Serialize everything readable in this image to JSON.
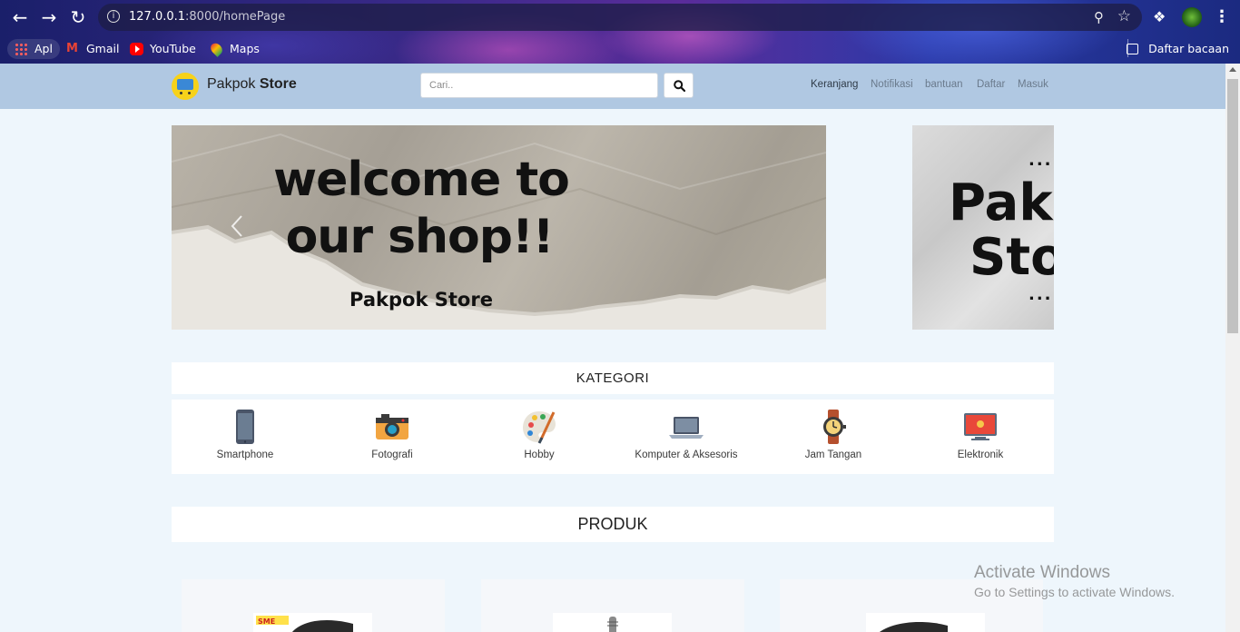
{
  "browser": {
    "url_host": "127.0.0.1",
    "url_path": ":8000/homePage",
    "bookmarks": [
      {
        "label": "Apl",
        "icon": "apps-grid-icon"
      },
      {
        "label": "Gmail",
        "icon": "gmail-icon"
      },
      {
        "label": "YouTube",
        "icon": "youtube-icon"
      },
      {
        "label": "Maps",
        "icon": "maps-icon"
      }
    ],
    "reading_list": "Daftar bacaan"
  },
  "header": {
    "brand_light": "Pakpok",
    "brand_bold": "Store",
    "search_placeholder": "Cari..",
    "nav": [
      "Keranjang",
      "Notifikasi",
      "bantuan",
      "Daftar",
      "Masuk"
    ]
  },
  "carousel": {
    "slide1_line1": "welcome to",
    "slide1_line2": "our shop!!",
    "slide1_sub": "Pakpok Store",
    "slide2_dots": "....",
    "slide2_line1": "Pakpok",
    "slide2_line2": "Store"
  },
  "kategori": {
    "title": "KATEGORI",
    "items": [
      {
        "label": "Smartphone",
        "icon": "smartphone-icon"
      },
      {
        "label": "Fotografi",
        "icon": "camera-icon"
      },
      {
        "label": "Hobby",
        "icon": "palette-icon"
      },
      {
        "label": "Komputer & Aksesoris",
        "icon": "laptop-icon"
      },
      {
        "label": "Jam Tangan",
        "icon": "watch-icon"
      },
      {
        "label": "Elektronik",
        "icon": "tv-icon"
      }
    ]
  },
  "produk": {
    "title": "PRODUK"
  },
  "watermark": {
    "line1": "Activate Windows",
    "line2": "Go to Settings to activate Windows."
  },
  "colors": {
    "header_bg": "#b0c8e2",
    "page_bg": "#eef6fc",
    "logo_yellow": "#f7d21a"
  }
}
